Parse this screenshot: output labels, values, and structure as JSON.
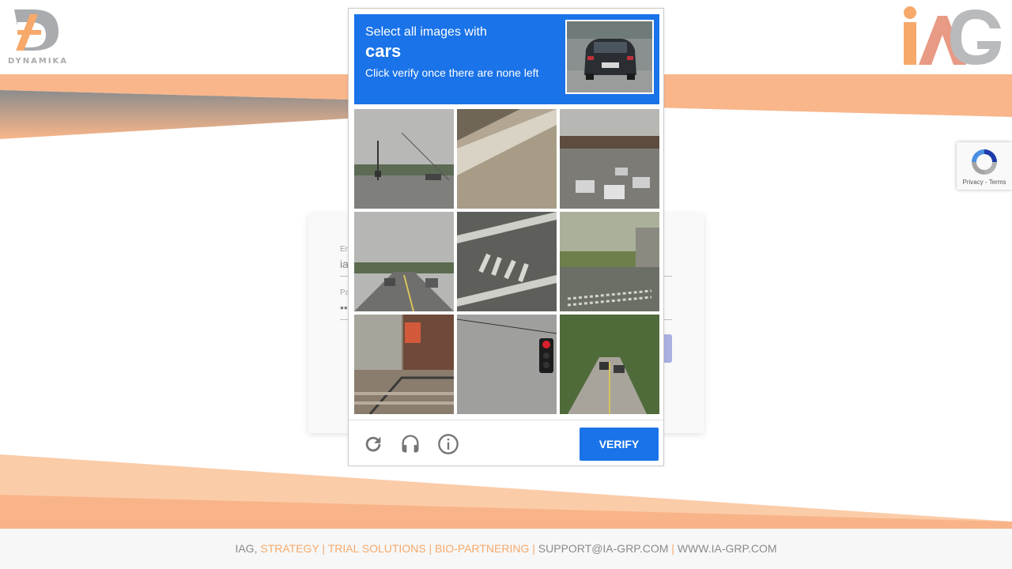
{
  "brand": {
    "left_logo_text": "DYNAMIKA",
    "right_logo_text": "iAG",
    "accent_color": "#f7a96a",
    "gray_color": "#a9abae"
  },
  "login": {
    "email_label": "Em",
    "email_value": "ia",
    "password_label": "Pa",
    "password_value": "••"
  },
  "captcha": {
    "instruction_line1": "Select all images with",
    "target_object": "cars",
    "instruction_line3": "Click verify once there are none left",
    "verify_label": "VERIFY",
    "header_color": "#1a73e8",
    "icons": [
      "reload-icon",
      "headphones-icon",
      "info-icon"
    ],
    "tiles": [
      "street-intersection",
      "sidewalk-curb",
      "traffic-under-bridge",
      "road-with-cars",
      "crosswalk-marking",
      "crosswalk-park",
      "storefront-stairs",
      "traffic-light",
      "country-road-cars"
    ]
  },
  "recaptcha_badge": {
    "text": "Privacy - Terms"
  },
  "footer": {
    "company": "IAG,",
    "item1": "STRATEGY",
    "item2": "TRIAL SOLUTIONS",
    "item3": "BIO-PARTNERING",
    "email": "SUPPORT@IA-GRP.COM",
    "website": "WWW.IA-GRP.COM"
  }
}
